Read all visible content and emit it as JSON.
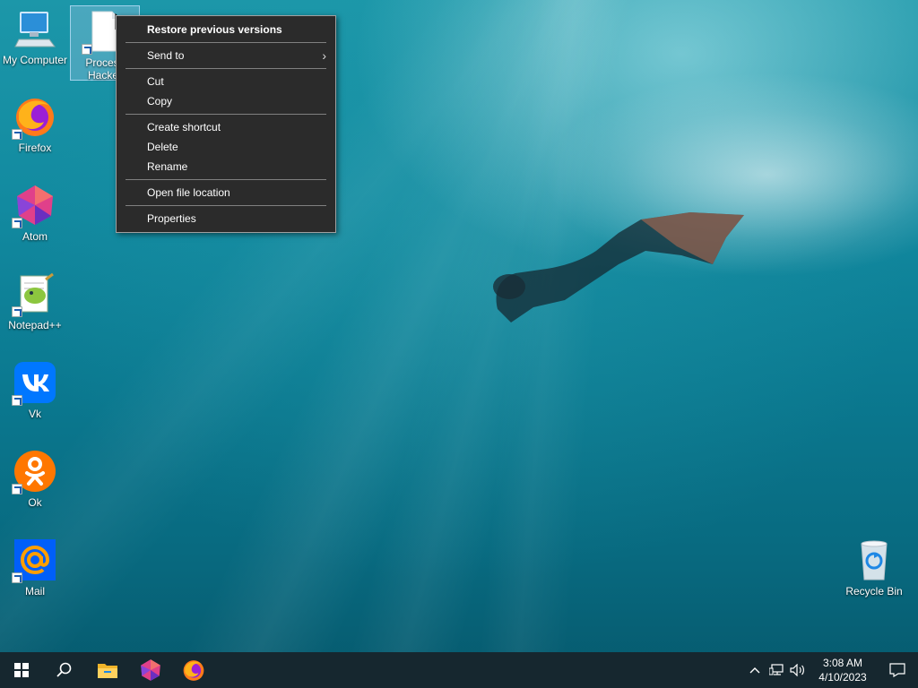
{
  "desktop": {
    "icons": [
      {
        "label": "My Computer"
      },
      {
        "label": "Process Hacker"
      },
      {
        "label": "Firefox"
      },
      {
        "label": "Atom"
      },
      {
        "label": "Notepad++"
      },
      {
        "label": "Vk"
      },
      {
        "label": "Ok"
      },
      {
        "label": "Mail"
      },
      {
        "label": "Recycle Bin"
      }
    ],
    "selected_icon": "Process Hacker"
  },
  "context_menu": {
    "items": [
      {
        "label": "Restore previous versions",
        "bold": true
      },
      {
        "label": "Send to",
        "submenu": true
      },
      {
        "label": "Cut"
      },
      {
        "label": "Copy"
      },
      {
        "label": "Create shortcut"
      },
      {
        "label": "Delete"
      },
      {
        "label": "Rename"
      },
      {
        "label": "Open file location"
      },
      {
        "label": "Properties"
      }
    ]
  },
  "taskbar": {
    "pinned": [
      "start-icon",
      "search-icon",
      "file-explorer-icon",
      "atom-icon",
      "firefox-icon"
    ],
    "tray_icons": [
      "chevron-up-icon",
      "network-icon",
      "volume-icon"
    ],
    "clock": {
      "time": "3:08 AM",
      "date": "4/10/2023"
    },
    "notification_icon": "notification-icon"
  },
  "colors": {
    "taskbar_bg": "#16272f",
    "menu_bg": "#2b2b2b",
    "wallpaper_water": "#0b7a91"
  }
}
